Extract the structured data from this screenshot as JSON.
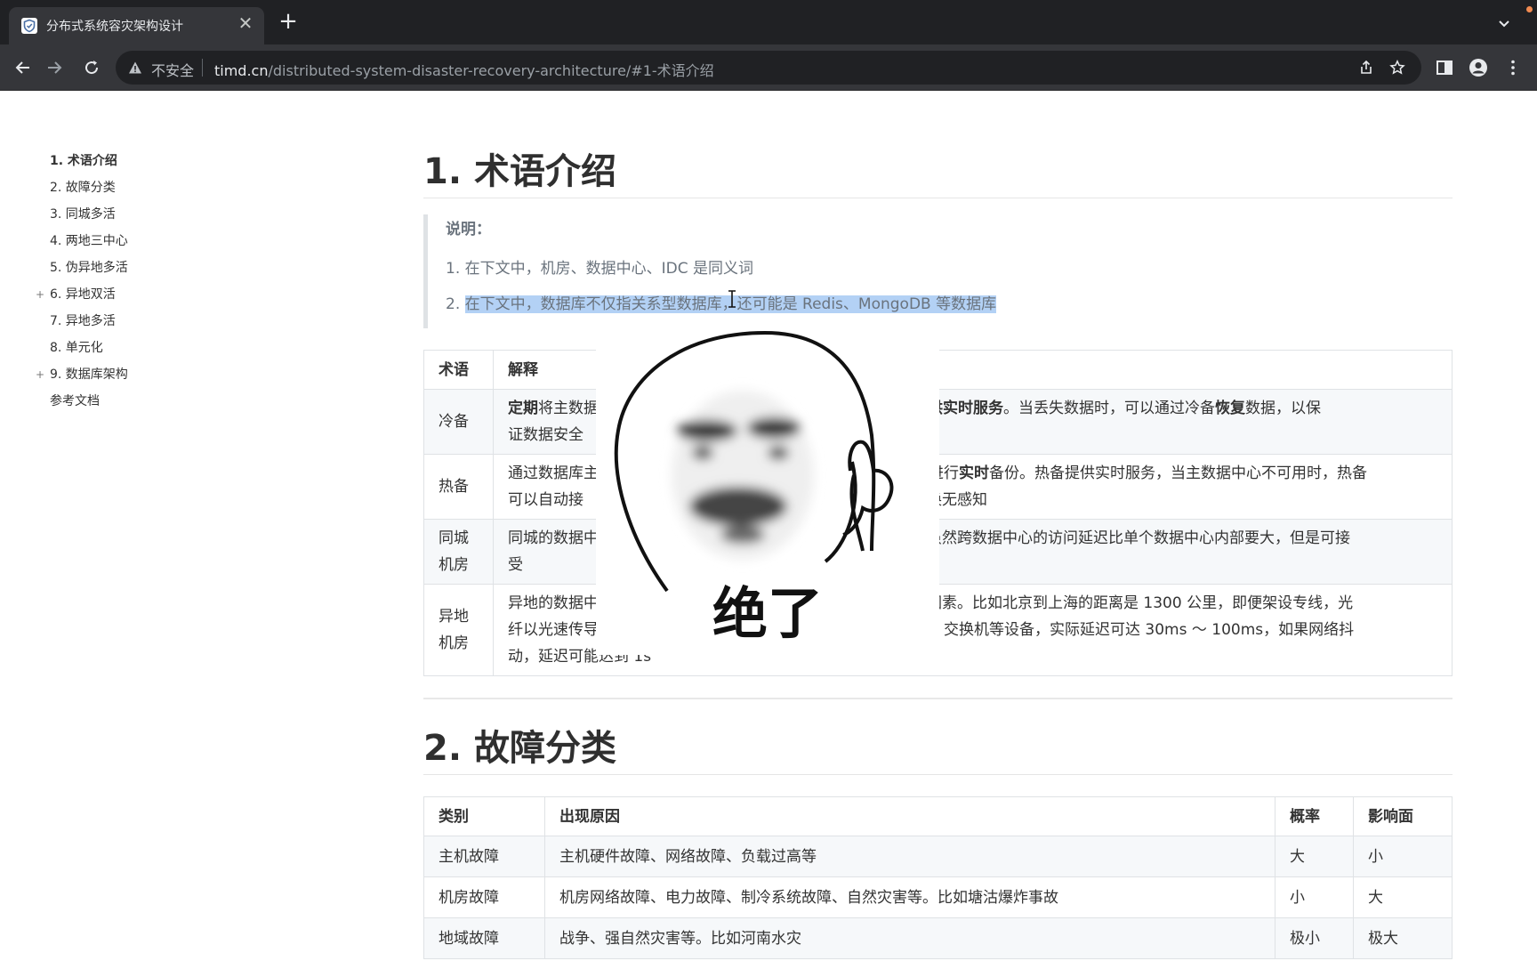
{
  "browser": {
    "tab_title": "分布式系统容灾架构设计",
    "close_glyph": "✕",
    "new_tab_glyph": "+",
    "insecure_label": "不安全",
    "url_host": "timd.cn",
    "url_path": "/distributed-system-disaster-recovery-architecture/#1-术语介绍",
    "accent": "#35363a"
  },
  "toc": {
    "items": [
      {
        "label": "1. 术语介绍",
        "active": true,
        "expandable": false
      },
      {
        "label": "2. 故障分类",
        "active": false,
        "expandable": false
      },
      {
        "label": "3. 同城多活",
        "active": false,
        "expandable": false
      },
      {
        "label": "4. 两地三中心",
        "active": false,
        "expandable": false
      },
      {
        "label": "5. 伪异地多活",
        "active": false,
        "expandable": false
      },
      {
        "label": "6. 异地双活",
        "active": false,
        "expandable": true
      },
      {
        "label": "7. 异地多活",
        "active": false,
        "expandable": false
      },
      {
        "label": "8. 单元化",
        "active": false,
        "expandable": false
      },
      {
        "label": "9. 数据库架构",
        "active": false,
        "expandable": true
      },
      {
        "label": "参考文档",
        "active": false,
        "expandable": false
      }
    ],
    "plus_glyph": "+"
  },
  "section1": {
    "title": "1. 术语介绍",
    "note_title": "说明：",
    "note_items": [
      {
        "num": "1. ",
        "text": "在下文中，机房、数据中心、IDC 是同义词"
      },
      {
        "num": "2. ",
        "text": "在下文中，数据库不仅指关系型数据库，还可能是 Redis、MongoDB 等数据库"
      }
    ],
    "table": {
      "headers": [
        "术语",
        "解释"
      ],
      "rows": [
        {
          "term": "冷备",
          "lead_bold": "定期",
          "text_a": "将主数据",
          "bold_b": "备不提供实时服务",
          "text_c": "。当丢失数据时，可以通过冷备",
          "bold_d": "恢复",
          "text_e": "数据，以保",
          "line2": "证数据安全"
        },
        {
          "term": "热备",
          "text_a": "通过数据库主",
          "text_b": "进行",
          "bold_b": "实时",
          "text_c": "备份。热备提供实时服务，当主数据中心不可用时，热备",
          "line2_a": "可以自动接",
          "line2_b": "切换无感知"
        },
        {
          "term": "同城机房",
          "text_a": "同城的数据中",
          "text_c": "，虽然跨数据中心的访问延迟比单个数据中心内部要大，但是可接",
          "line2": "受"
        },
        {
          "term": "异地机房",
          "text_a": "异地的数据中",
          "text_c": "的因素。比如北京到上海的距离是 1300 公里，即便架设专线，光",
          "line2_a": "纤以光速传导",
          "line2_b": "器、交换机等设备，实际延迟可达 30ms ～ 100ms，如果网络抖",
          "line3": "动，延迟可能达到 1s"
        }
      ]
    }
  },
  "section2": {
    "title": "2. 故障分类",
    "table": {
      "headers": [
        "类别",
        "出现原因",
        "概率",
        "影响面"
      ],
      "rows": [
        [
          "主机故障",
          "主机硬件故障、网络故障、负载过高等",
          "大",
          "小"
        ],
        [
          "机房故障",
          "机房网络故障、电力故障、制冷系统故障、自然灾害等。比如塘沽爆炸事故",
          "小",
          "大"
        ],
        [
          "地域故障",
          "战争、强自然灾害等。比如河南水灾",
          "极小",
          "极大"
        ]
      ]
    }
  },
  "meme": {
    "caption": "绝了",
    "icon": "thumbs-up-ghost-meme"
  }
}
